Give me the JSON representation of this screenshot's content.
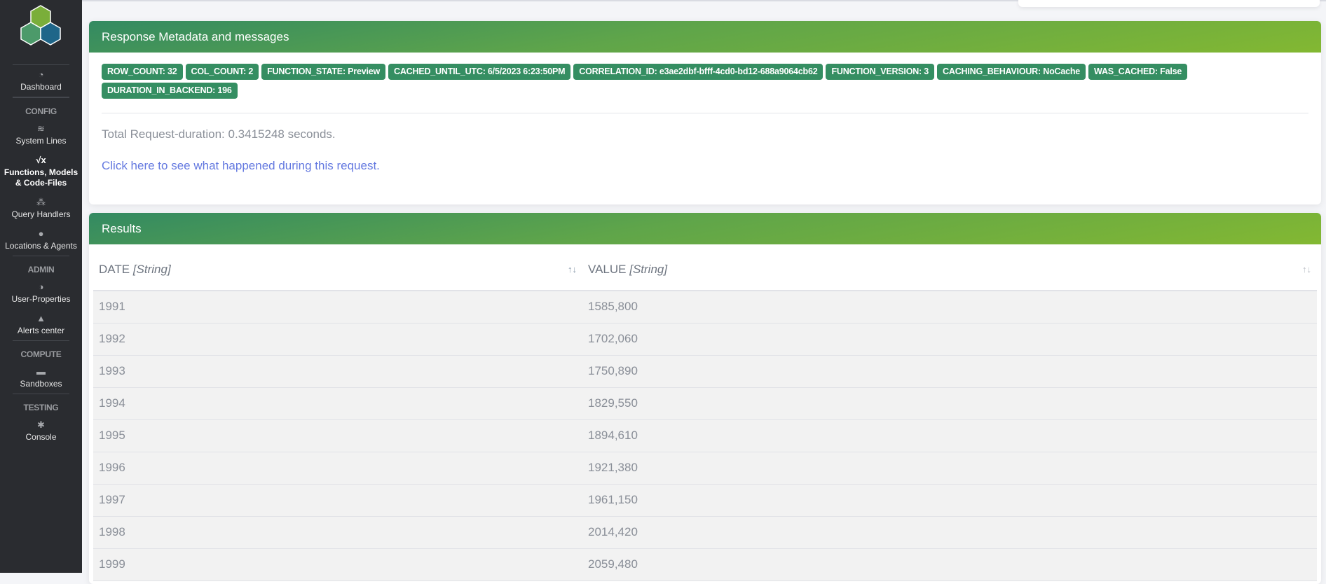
{
  "sidebar": {
    "items": [
      {
        "label": "Dashboard",
        "icon": "dashboard-icon"
      },
      {
        "section": "CONFIG"
      },
      {
        "label": "System Lines",
        "icon": "layers-icon"
      },
      {
        "label": "Functions, Models & Code-Files",
        "icon": "sqrt-x-icon",
        "active": true
      },
      {
        "label": "Query Handlers",
        "icon": "cubes-icon"
      },
      {
        "label": "Locations & Agents",
        "icon": "map-marker-icon"
      },
      {
        "section": "ADMIN"
      },
      {
        "label": "User-Properties",
        "icon": "shield-icon"
      },
      {
        "label": "Alerts center",
        "icon": "bell-icon"
      },
      {
        "section": "COMPUTE"
      },
      {
        "label": "Sandboxes",
        "icon": "briefcase-icon"
      },
      {
        "section": "TESTING"
      },
      {
        "label": "Console",
        "icon": "bug-icon"
      }
    ]
  },
  "metadata": {
    "title": "Response Metadata and messages",
    "badges": [
      "ROW_COUNT: 32",
      "COL_COUNT: 2",
      "FUNCTION_STATE: Preview",
      "CACHED_UNTIL_UTC: 6/5/2023 6:23:50PM",
      "CORRELATION_ID: e3ae2dbf-bfff-4cd0-bd12-688a9064cb62",
      "FUNCTION_VERSION: 3",
      "CACHING_BEHAVIOUR: NoCache",
      "WAS_CACHED: False",
      "DURATION_IN_BACKEND: 196"
    ],
    "duration": "Total Request-duration: 0.3415248 seconds.",
    "link": "Click here to see what happened during this request."
  },
  "results": {
    "title": "Results",
    "columns": [
      {
        "name": "DATE",
        "type": "[String]"
      },
      {
        "name": "VALUE",
        "type": "[String]"
      }
    ],
    "rows": [
      [
        "1991",
        "1585,800"
      ],
      [
        "1992",
        "1702,060"
      ],
      [
        "1993",
        "1750,890"
      ],
      [
        "1994",
        "1829,550"
      ],
      [
        "1995",
        "1894,610"
      ],
      [
        "1996",
        "1921,380"
      ],
      [
        "1997",
        "1961,150"
      ],
      [
        "1998",
        "2014,420"
      ],
      [
        "1999",
        "2059,480"
      ]
    ]
  }
}
